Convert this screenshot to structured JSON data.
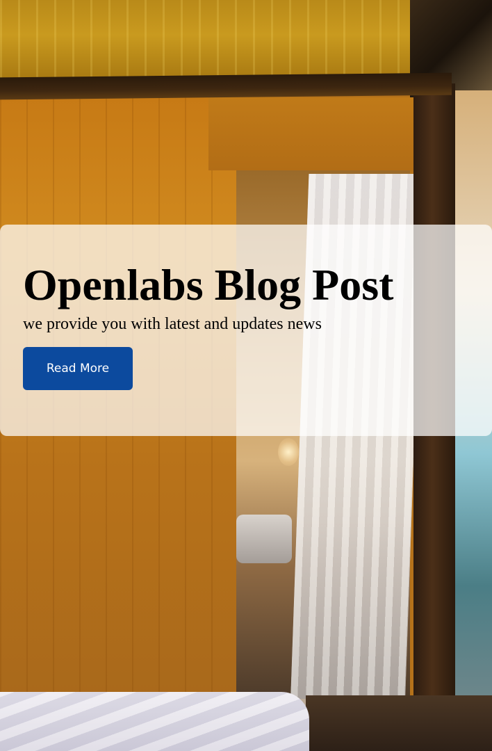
{
  "hero": {
    "title": "Openlabs Blog Post",
    "subtitle": "we provide you with latest and updates news",
    "cta_label": "Read More",
    "cta_color": "#0c4a9e",
    "card_color": "rgba(255,255,255,0.72)"
  }
}
